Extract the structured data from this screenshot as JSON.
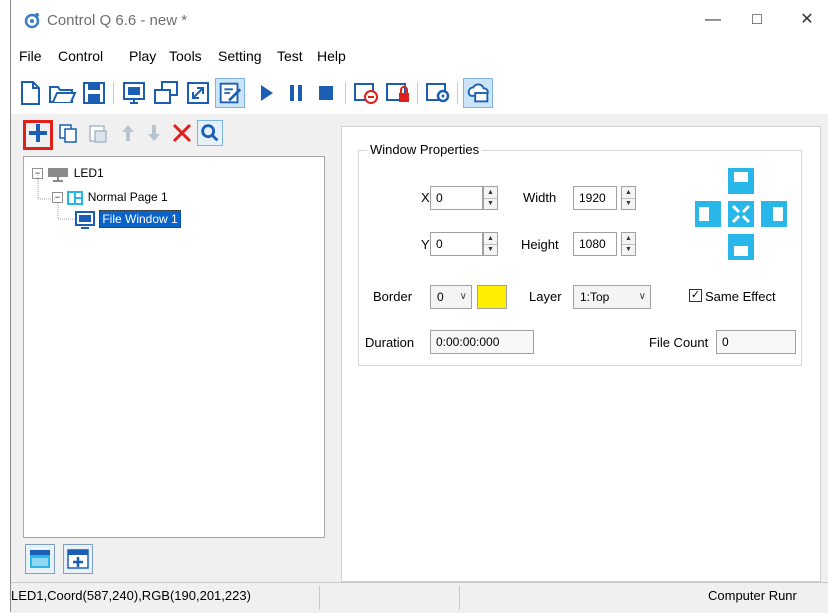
{
  "window": {
    "title": "Control Q 6.6 - new *",
    "minimize": "—",
    "maximize": "□",
    "close": "✕"
  },
  "menu": [
    "File",
    "Control",
    "Play",
    "Tools",
    "Setting",
    "Test",
    "Help"
  ],
  "tree": {
    "screen": "LED1",
    "page": "Normal Page 1",
    "window": "File Window 1"
  },
  "properties": {
    "group_title": "Window Properties",
    "x_label": "X",
    "x_value": "0",
    "y_label": "Y",
    "y_value": "0",
    "width_label": "Width",
    "width_value": "1920",
    "height_label": "Height",
    "height_value": "1080",
    "border_label": "Border",
    "border_value": "0",
    "border_color": "#ffee00",
    "layer_label": "Layer",
    "layer_value": "1:Top",
    "same_effect_label": "Same Effect",
    "same_effect_checked": true,
    "duration_label": "Duration",
    "duration_value": "0:00:00:000",
    "file_count_label": "File Count",
    "file_count_value": "0"
  },
  "status": {
    "left": "LED1,Coord(587,240),RGB(190,201,223)",
    "right": "Computer Runr"
  },
  "colors": {
    "accent_blue": "#1a5fb4",
    "icon_cyan": "#29b6e8",
    "red_highlight": "#e0201a",
    "selection": "#0a64c8"
  }
}
